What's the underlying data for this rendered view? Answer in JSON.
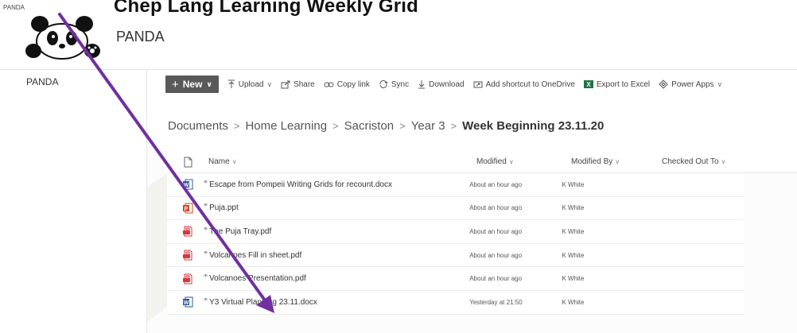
{
  "overlay": {
    "title": "Chep Lang Learning Weekly Grid"
  },
  "site": {
    "tiny_label": "PANDA",
    "name": "PANDA"
  },
  "leftnav": {
    "item": "PANDA"
  },
  "commands": {
    "new": "New",
    "upload": "Upload",
    "share": "Share",
    "copy_link": "Copy link",
    "sync": "Sync",
    "download": "Download",
    "add_shortcut": "Add shortcut to OneDrive",
    "export_excel": "Export to Excel",
    "power_apps": "Power Apps"
  },
  "breadcrumb": [
    "Documents",
    "Home Learning",
    "Sacriston",
    "Year 3",
    "Week Beginning 23.11.20"
  ],
  "columns": {
    "name": "Name",
    "modified": "Modified",
    "modified_by": "Modified By",
    "checked_out": "Checked Out To"
  },
  "files": [
    {
      "name": "Escape from Pompeii Writing Grids for recount.docx",
      "type": "word",
      "modified": "About an hour ago",
      "modified_by": "K White"
    },
    {
      "name": "Puja.ppt",
      "type": "powerpoint",
      "modified": "About an hour ago",
      "modified_by": "K White"
    },
    {
      "name": "The Puja Tray.pdf",
      "type": "pdf",
      "modified": "About an hour ago",
      "modified_by": "K White"
    },
    {
      "name": "Volcanoes Fill in sheet.pdf",
      "type": "pdf",
      "modified": "About an hour ago",
      "modified_by": "K White"
    },
    {
      "name": "Volcanoes Presentation.pdf",
      "type": "pdf",
      "modified": "About an hour ago",
      "modified_by": "K White"
    },
    {
      "name": "Y3 Virtual Planning 23.11.docx",
      "type": "word",
      "modified": "Yesterday at 21:50",
      "modified_by": "K White"
    }
  ],
  "colors": {
    "command_new_bg": "#595959",
    "arrow": "#7030a0",
    "word": "#2b579a",
    "powerpoint": "#d24726",
    "pdf": "#d9363e",
    "excel": "#217346"
  }
}
